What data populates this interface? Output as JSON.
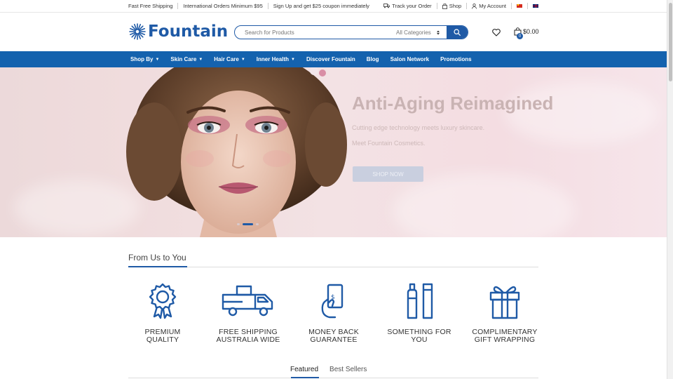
{
  "topbar": {
    "promos": [
      "Fast Free Shipping",
      "International Orders Minimum $95",
      "Sign Up and get $25 coupon immediately"
    ],
    "track_order": "Track your Order",
    "shop": "Shop",
    "my_account": "My Account"
  },
  "header": {
    "logo_text": "Fountain",
    "search_placeholder": "Search for Products",
    "category_selected": "All Categories",
    "cart_total": "$0.00",
    "cart_count": "0"
  },
  "nav": {
    "items": [
      {
        "label": "Shop By",
        "dropdown": true
      },
      {
        "label": "Skin Care",
        "dropdown": true
      },
      {
        "label": "Hair Care",
        "dropdown": true
      },
      {
        "label": "Inner Health",
        "dropdown": true
      },
      {
        "label": "Discover Fountain",
        "dropdown": false
      },
      {
        "label": "Blog",
        "dropdown": false
      },
      {
        "label": "Salon Network",
        "dropdown": false
      },
      {
        "label": "Promotions",
        "dropdown": false
      }
    ]
  },
  "hero": {
    "title": "Anti-Aging Reimagined",
    "subtitle_1": "Cutting edge technology meets luxury skincare.",
    "subtitle_2": "Meet Fountain Cosmetics.",
    "cta": "SHOP NOW",
    "slide_count": 3,
    "active_slide": 2
  },
  "from_us": {
    "title": "From Us to You",
    "features": [
      {
        "icon": "award-ribbon-icon",
        "label_line1": "PREMIUM",
        "label_line2": "QUALITY"
      },
      {
        "icon": "delivery-truck-icon",
        "label_line1": "FREE SHIPPING",
        "label_line2": "AUSTRALIA WIDE"
      },
      {
        "icon": "money-back-hand-icon",
        "label_line1": "MONEY BACK",
        "label_line2": "GUARANTEE"
      },
      {
        "icon": "cosmetic-bottles-icon",
        "label_line1": "SOMETHING FOR",
        "label_line2": "YOU"
      },
      {
        "icon": "gift-box-icon",
        "label_line1": "COMPLIMENTARY",
        "label_line2": "GIFT WRAPPING"
      }
    ]
  },
  "product_tabs": {
    "tabs": [
      "Featured",
      "Best Sellers"
    ],
    "active": "Featured"
  },
  "colors": {
    "brand_blue": "#1f5aa6",
    "nav_blue": "#1462ae"
  }
}
